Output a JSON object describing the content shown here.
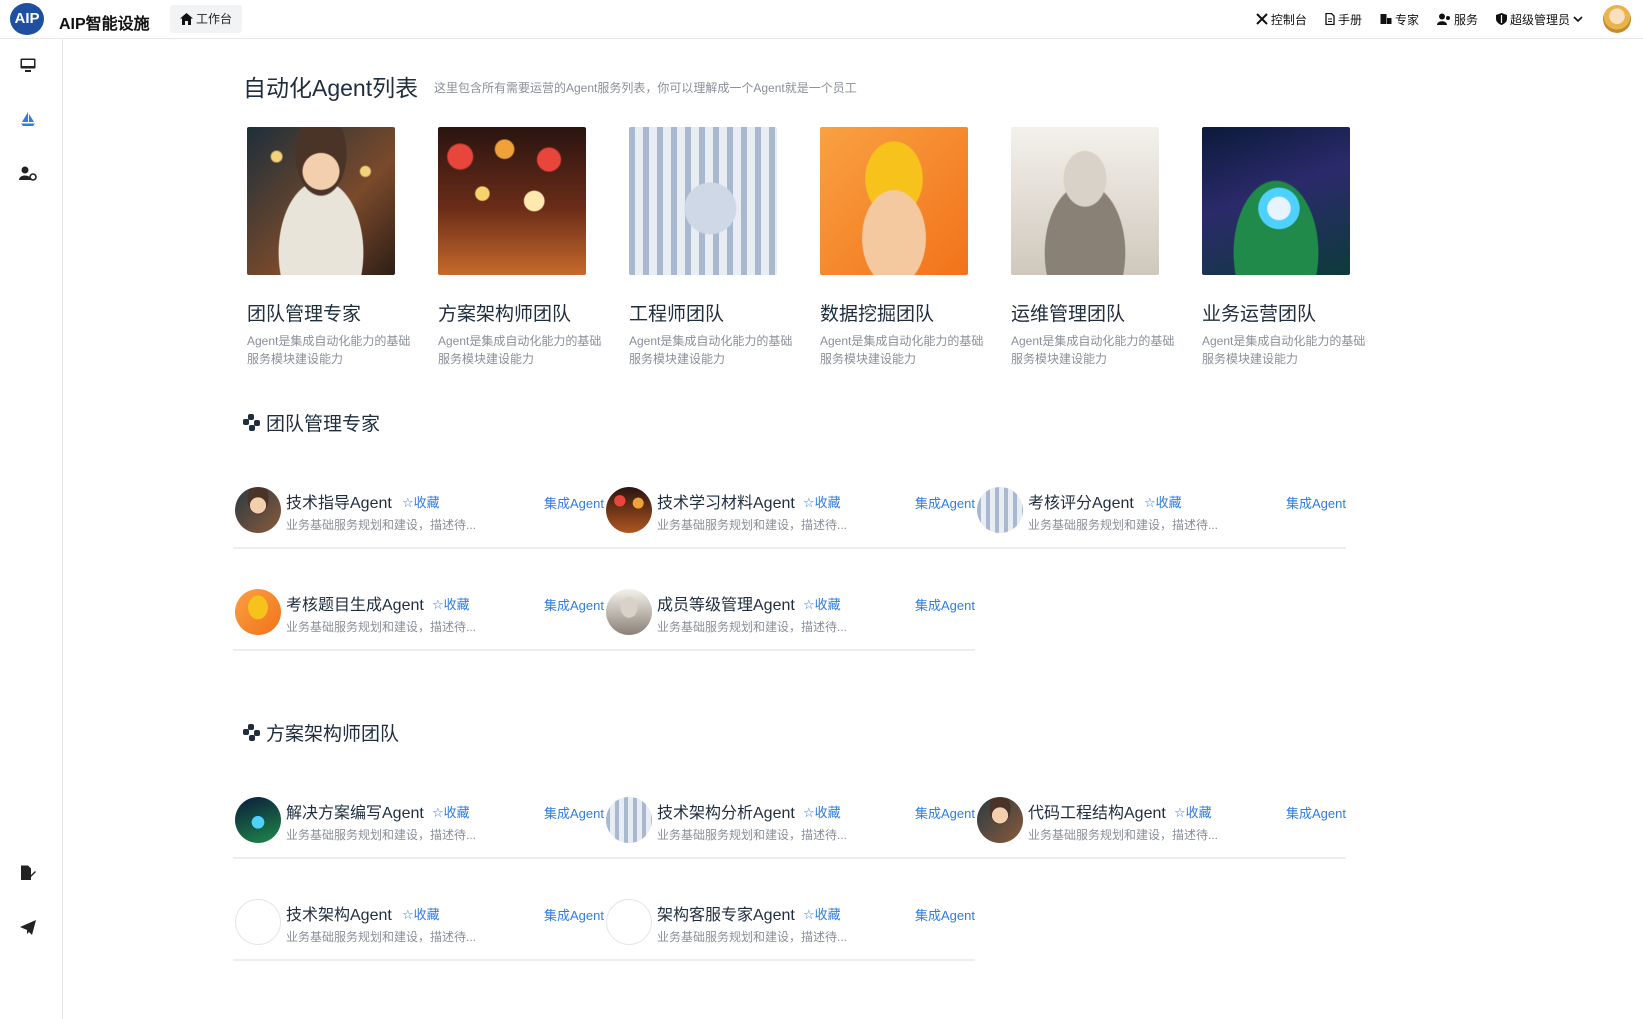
{
  "header": {
    "logo_text": "AIP",
    "app_title": "AIP智能设施",
    "workbench_tab": "工作台",
    "nav": [
      {
        "label": "控制台",
        "icon": "tools-icon"
      },
      {
        "label": "手册",
        "icon": "document-icon"
      },
      {
        "label": "专家",
        "icon": "expert-icon"
      },
      {
        "label": "服务",
        "icon": "users-icon"
      },
      {
        "label": "超级管理员",
        "icon": "shield-icon"
      }
    ]
  },
  "sidebar": {
    "items": [
      {
        "icon": "monitor-icon",
        "active": false
      },
      {
        "icon": "sailboat-icon",
        "active": true
      },
      {
        "icon": "user-settings-icon",
        "active": false
      },
      {
        "icon": "file-edit-icon",
        "active": false
      },
      {
        "icon": "send-icon",
        "active": false
      }
    ]
  },
  "page": {
    "title": "自动化Agent列表",
    "subtitle": "这里包含所有需要运营的Agent服务列表，你可以理解成一个Agent就是一个员工"
  },
  "teams": [
    {
      "name": "团队管理专家",
      "desc": "Agent是集成自动化能力的基础服务模块建设能力"
    },
    {
      "name": "方案架构师团队",
      "desc": "Agent是集成自动化能力的基础服务模块建设能力"
    },
    {
      "name": "工程师团队",
      "desc": "Agent是集成自动化能力的基础服务模块建设能力"
    },
    {
      "name": "数据挖掘团队",
      "desc": "Agent是集成自动化能力的基础服务模块建设能力"
    },
    {
      "name": "运维管理团队",
      "desc": "Agent是集成自动化能力的基础服务模块建设能力"
    },
    {
      "name": "业务运营团队",
      "desc": "Agent是集成自动化能力的基础服务模块建设能力"
    }
  ],
  "sections": [
    {
      "title": "团队管理专家",
      "agents": [
        {
          "name": "技术指导Agent",
          "fav": "收藏",
          "desc": "业务基础服务规划和建设，描述待...",
          "action": "集成Agent"
        },
        {
          "name": "技术学习材料Agent",
          "fav": "收藏",
          "desc": "业务基础服务规划和建设，描述待...",
          "action": "集成Agent"
        },
        {
          "name": "考核评分Agent",
          "fav": "收藏",
          "desc": "业务基础服务规划和建设，描述待...",
          "action": "集成Agent"
        },
        {
          "name": "考核题目生成Agent",
          "fav": "收藏",
          "desc": "业务基础服务规划和建设，描述待...",
          "action": "集成Agent"
        },
        {
          "name": "成员等级管理Agent",
          "fav": "收藏",
          "desc": "业务基础服务规划和建设，描述待...",
          "action": "集成Agent"
        }
      ]
    },
    {
      "title": "方案架构师团队",
      "agents": [
        {
          "name": "解决方案编写Agent",
          "fav": "收藏",
          "desc": "业务基础服务规划和建设，描述待...",
          "action": "集成Agent"
        },
        {
          "name": "技术架构分析Agent",
          "fav": "收藏",
          "desc": "业务基础服务规划和建设，描述待...",
          "action": "集成Agent"
        },
        {
          "name": "代码工程结构Agent",
          "fav": "收藏",
          "desc": "业务基础服务规划和建设，描述待...",
          "action": "集成Agent"
        },
        {
          "name": "技术架构Agent",
          "fav": "收藏",
          "desc": "业务基础服务规划和建设，描述待...",
          "action": "集成Agent"
        },
        {
          "name": "架构客服专家Agent",
          "fav": "收藏",
          "desc": "业务基础服务规划和建设，描述待...",
          "action": "集成Agent"
        }
      ]
    }
  ],
  "colors": {
    "accent": "#2f7de1",
    "logo_bg": "#1e4fa1",
    "muted_text": "#8a8f98"
  }
}
